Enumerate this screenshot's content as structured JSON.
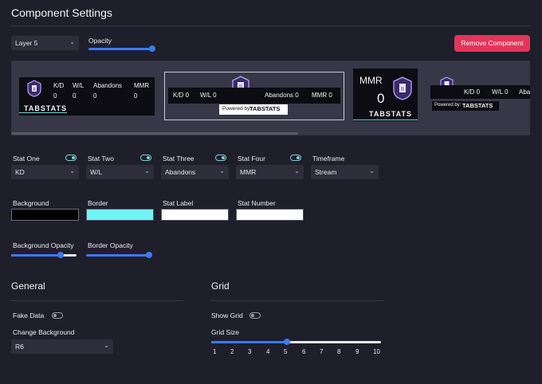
{
  "page": {
    "title": "Component Settings"
  },
  "layer": {
    "selected": "Layer 5"
  },
  "opacity": {
    "label": "Opacity",
    "value": 1.0
  },
  "remove_button": {
    "label": "Remove Component"
  },
  "preview": {
    "card1": {
      "labels": [
        "K/D",
        "W/L",
        "Abandons",
        "MMR"
      ],
      "values": [
        "0",
        "0",
        "0",
        "0"
      ],
      "brand": "TABSTATS"
    },
    "card2": {
      "k1": "K/D",
      "v1": "0",
      "k2": "W/L",
      "v2": "0",
      "k3": "Abandons",
      "v3": "0",
      "k4": "MMR",
      "v4": "0",
      "powered": "Powered by:",
      "brand": "TABSTATS"
    },
    "card3": {
      "label": "MMR",
      "value": "0",
      "brand": "TABSTATS"
    },
    "card4": {
      "k1": "K/D",
      "v1": "0",
      "k2": "W/L",
      "v2": "0",
      "k3": "Aba",
      "powered": "Powered by:",
      "brand": "TABSTATS"
    }
  },
  "stats": [
    {
      "label": "Stat One",
      "value": "KD",
      "toggle": true
    },
    {
      "label": "Stat Two",
      "value": "W/L",
      "toggle": true
    },
    {
      "label": "Stat Three",
      "value": "Abandons",
      "toggle": true
    },
    {
      "label": "Stat Four",
      "value": "MMR",
      "toggle": true
    },
    {
      "label": "Timeframe",
      "value": "Stream"
    }
  ],
  "colors": [
    {
      "label": "Background",
      "color": "#000000"
    },
    {
      "label": "Border",
      "color": "#6ff5f6"
    },
    {
      "label": "Stat Label",
      "color": "#ffffff"
    },
    {
      "label": "Stat Number",
      "color": "#ffffff"
    }
  ],
  "opacities": {
    "background": {
      "label": "Background Opacity",
      "value": 0.7
    },
    "border": {
      "label": "Border Opacity",
      "value": 1.0
    }
  },
  "general": {
    "title": "General",
    "fake_data": {
      "label": "Fake Data",
      "on": false
    },
    "change_background": {
      "label": "Change Background",
      "value": "R6"
    }
  },
  "grid": {
    "title": "Grid",
    "show_grid": {
      "label": "Show Grid",
      "on": false
    },
    "size": {
      "label": "Grid Size",
      "ticks": [
        "1",
        "2",
        "3",
        "4",
        "5",
        "6",
        "7",
        "8",
        "9",
        "10"
      ],
      "value": 5
    }
  },
  "colors_ui": {
    "accent": "#3a7bf0",
    "danger": "#e4365b",
    "teal": "#6fd4d8",
    "bg": "#1f1e2b"
  }
}
